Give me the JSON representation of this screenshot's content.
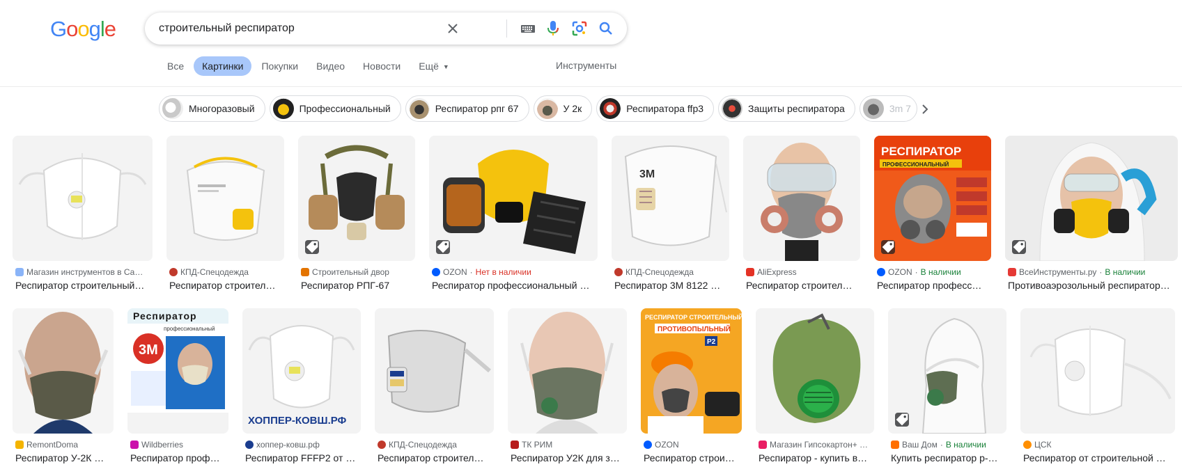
{
  "logo": {
    "letters": [
      "G",
      "o",
      "o",
      "g",
      "l",
      "e"
    ]
  },
  "search": {
    "query": "строительный респиратор"
  },
  "icons": {
    "clear": "close-icon",
    "keyboard": "keyboard-icon",
    "voice": "microphone-icon",
    "lens": "camera-lens-icon",
    "search": "search-icon"
  },
  "tabs": [
    {
      "label": "Все",
      "active": false
    },
    {
      "label": "Картинки",
      "active": true
    },
    {
      "label": "Покупки",
      "active": false
    },
    {
      "label": "Видео",
      "active": false
    },
    {
      "label": "Новости",
      "active": false
    },
    {
      "label": "Ещё",
      "active": false
    }
  ],
  "tools_label": "Инструменты",
  "chips": [
    "Многоразовый",
    "Профессиональный",
    "Респиратор рпг 67",
    "У 2к",
    "Респиратора ffp3",
    "Защиты респиратора",
    "3m 7"
  ],
  "colors": {
    "accent_tab": "#a8c7fa",
    "text_secondary": "#5f6368",
    "in_stock": "#188038",
    "out_of_stock": "#d93025"
  },
  "results": [
    {
      "source": "Магазин инструментов в Са…",
      "availability": "",
      "title": "Респиратор строительный…",
      "tagged": false
    },
    {
      "source": "КПД-Спецодежда",
      "availability": "",
      "title": "Респиратор строител…",
      "tagged": false
    },
    {
      "source": "Строительный двор",
      "availability": "",
      "title": "Респиратор РПГ-67",
      "tagged": true
    },
    {
      "source": "OZON",
      "availability": "Нет в наличии",
      "title": "Респиратор профессиональный …",
      "tagged": true
    },
    {
      "source": "КПД-Спецодежда",
      "availability": "",
      "title": "Респиратор 3М 8122 …",
      "tagged": false
    },
    {
      "source": "AliExpress",
      "availability": "",
      "title": "Респиратор строител…",
      "tagged": false
    },
    {
      "source": "OZON",
      "availability": "В наличии",
      "title": "Респиратор професс…",
      "tagged": true,
      "thumb_text": [
        "РЕСПИРАТОР",
        "ПРОФЕССИОНАЛЬНЫЙ"
      ]
    },
    {
      "source": "ВсеИнструменты.ру",
      "availability": "В наличии",
      "title": "Противоаэрозольный респиратор…",
      "tagged": true
    },
    {
      "source": "RemontDoma",
      "availability": "",
      "title": "Респиратор У-2К …",
      "tagged": false
    },
    {
      "source": "Wildberries",
      "availability": "",
      "title": "Респиратор проф…",
      "tagged": false,
      "thumb_text": [
        "Респиратор",
        "профессиональный",
        "3M"
      ]
    },
    {
      "source": "хоппер-ковш.рф",
      "availability": "",
      "title": "Респиратор FFFP2 от …",
      "tagged": false,
      "thumb_text": [
        "ХОППЕР-КОВШ.РФ"
      ]
    },
    {
      "source": "КПД-Спецодежда",
      "availability": "",
      "title": "Респиратор строител…",
      "tagged": false
    },
    {
      "source": "ТК РИМ",
      "availability": "",
      "title": "Респиратор У2К для з…",
      "tagged": false
    },
    {
      "source": "OZON",
      "availability": "",
      "title": "Респиратор строи…",
      "tagged": false,
      "thumb_text": [
        "РЕСПИРАТОР СТРОИТЕЛЬНЫЙ",
        "ПРОТИВОПЫЛЬНЫЙ",
        "P2"
      ]
    },
    {
      "source": "Магазин Гипсокартон+ …",
      "availability": "",
      "title": "Респиратор - купить в…",
      "tagged": false
    },
    {
      "source": "Ваш Дом",
      "availability": "В наличии",
      "title": "Купить респиратор р-…",
      "tagged": true
    },
    {
      "source": "ЦСК",
      "availability": "",
      "title": "Респиратор от строительной …",
      "tagged": false
    }
  ]
}
